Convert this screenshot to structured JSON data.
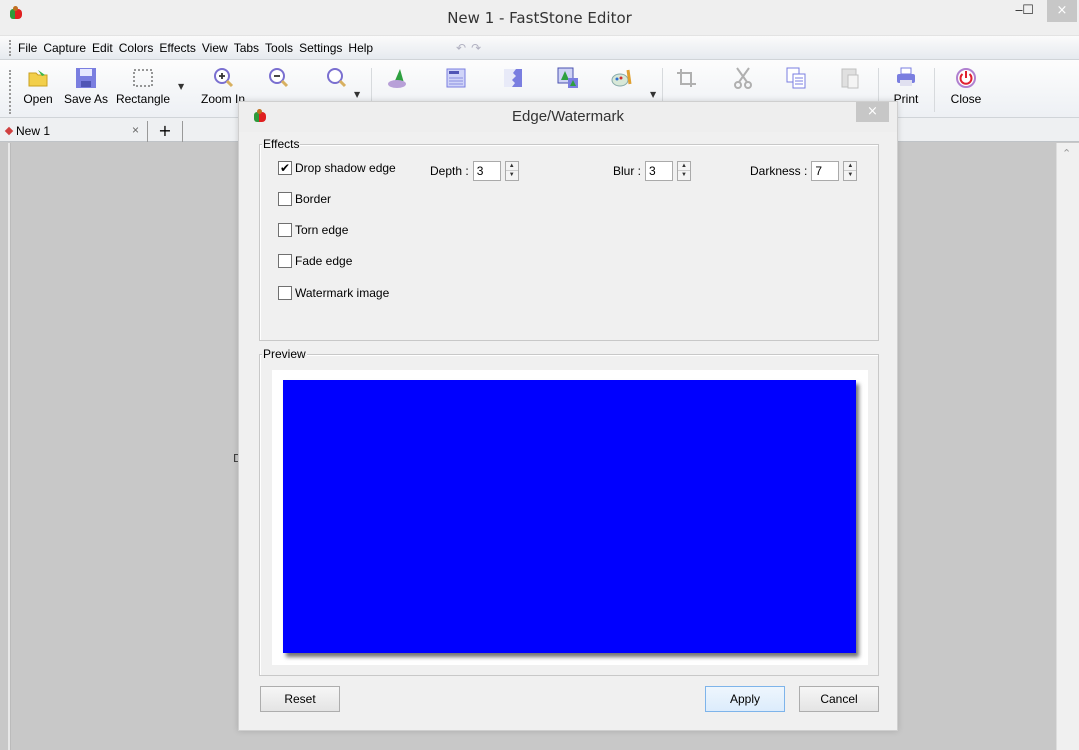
{
  "window": {
    "title": "New 1 - FastStone Editor",
    "controls": {
      "minimize": "‒",
      "maximize": "☐",
      "close": "×"
    }
  },
  "menu": {
    "items": [
      "File",
      "Capture",
      "Edit",
      "Colors",
      "Effects",
      "View",
      "Tabs",
      "Tools",
      "Settings",
      "Help"
    ],
    "undo_icon": "↶",
    "redo_icon": "↷"
  },
  "toolbar": {
    "buttons": [
      {
        "id": "open",
        "label": "Open",
        "icon": "open-folder-icon"
      },
      {
        "id": "save-as",
        "label": "Save As",
        "icon": "floppy-disk-icon"
      },
      {
        "id": "rectangle",
        "label": "Rectangle",
        "icon": "rectangle-select-icon"
      },
      {
        "id": "zoom-in",
        "label": "Zoom In",
        "icon": "zoom-in-icon"
      },
      {
        "id": "zoom-out",
        "label": "",
        "icon": "zoom-out-icon"
      },
      {
        "id": "zoom",
        "label": "",
        "icon": "zoom-icon"
      },
      {
        "id": "draw",
        "label": "",
        "icon": "draw-icon"
      },
      {
        "id": "caption",
        "label": "",
        "icon": "caption-icon"
      },
      {
        "id": "edge",
        "label": "",
        "icon": "edge-icon"
      },
      {
        "id": "watermark",
        "label": "",
        "icon": "watermark-icon"
      },
      {
        "id": "colors",
        "label": "",
        "icon": "palette-icon"
      },
      {
        "id": "crop",
        "label": "",
        "icon": "crop-icon"
      },
      {
        "id": "cut",
        "label": "",
        "icon": "scissors-icon"
      },
      {
        "id": "copy",
        "label": "",
        "icon": "copy-icon"
      },
      {
        "id": "paste",
        "label": "",
        "icon": "paste-icon"
      },
      {
        "id": "print",
        "label": "Print",
        "icon": "printer-icon"
      },
      {
        "id": "close",
        "label": "Close",
        "icon": "power-icon"
      }
    ]
  },
  "tabs": {
    "items": [
      {
        "label": "New 1",
        "close": "×"
      }
    ],
    "add_label": "+"
  },
  "canvas": {
    "partial_text": "D"
  },
  "dialog": {
    "title": "Edge/Watermark",
    "close": "×",
    "effects_group": {
      "legend": "Effects",
      "options": [
        {
          "label": "Drop shadow edge",
          "checked": true
        },
        {
          "label": "Border",
          "checked": false
        },
        {
          "label": "Torn edge",
          "checked": false
        },
        {
          "label": "Fade edge",
          "checked": false
        },
        {
          "label": "Watermark image",
          "checked": false
        }
      ],
      "depth": {
        "label": "Depth :",
        "value": "3"
      },
      "blur": {
        "label": "Blur :",
        "value": "3"
      },
      "darkness": {
        "label": "Darkness :",
        "value": "7"
      }
    },
    "preview_group": {
      "legend": "Preview",
      "image_color": "#0000ff"
    },
    "buttons": {
      "reset": "Reset",
      "apply": "Apply",
      "cancel": "Cancel"
    }
  }
}
